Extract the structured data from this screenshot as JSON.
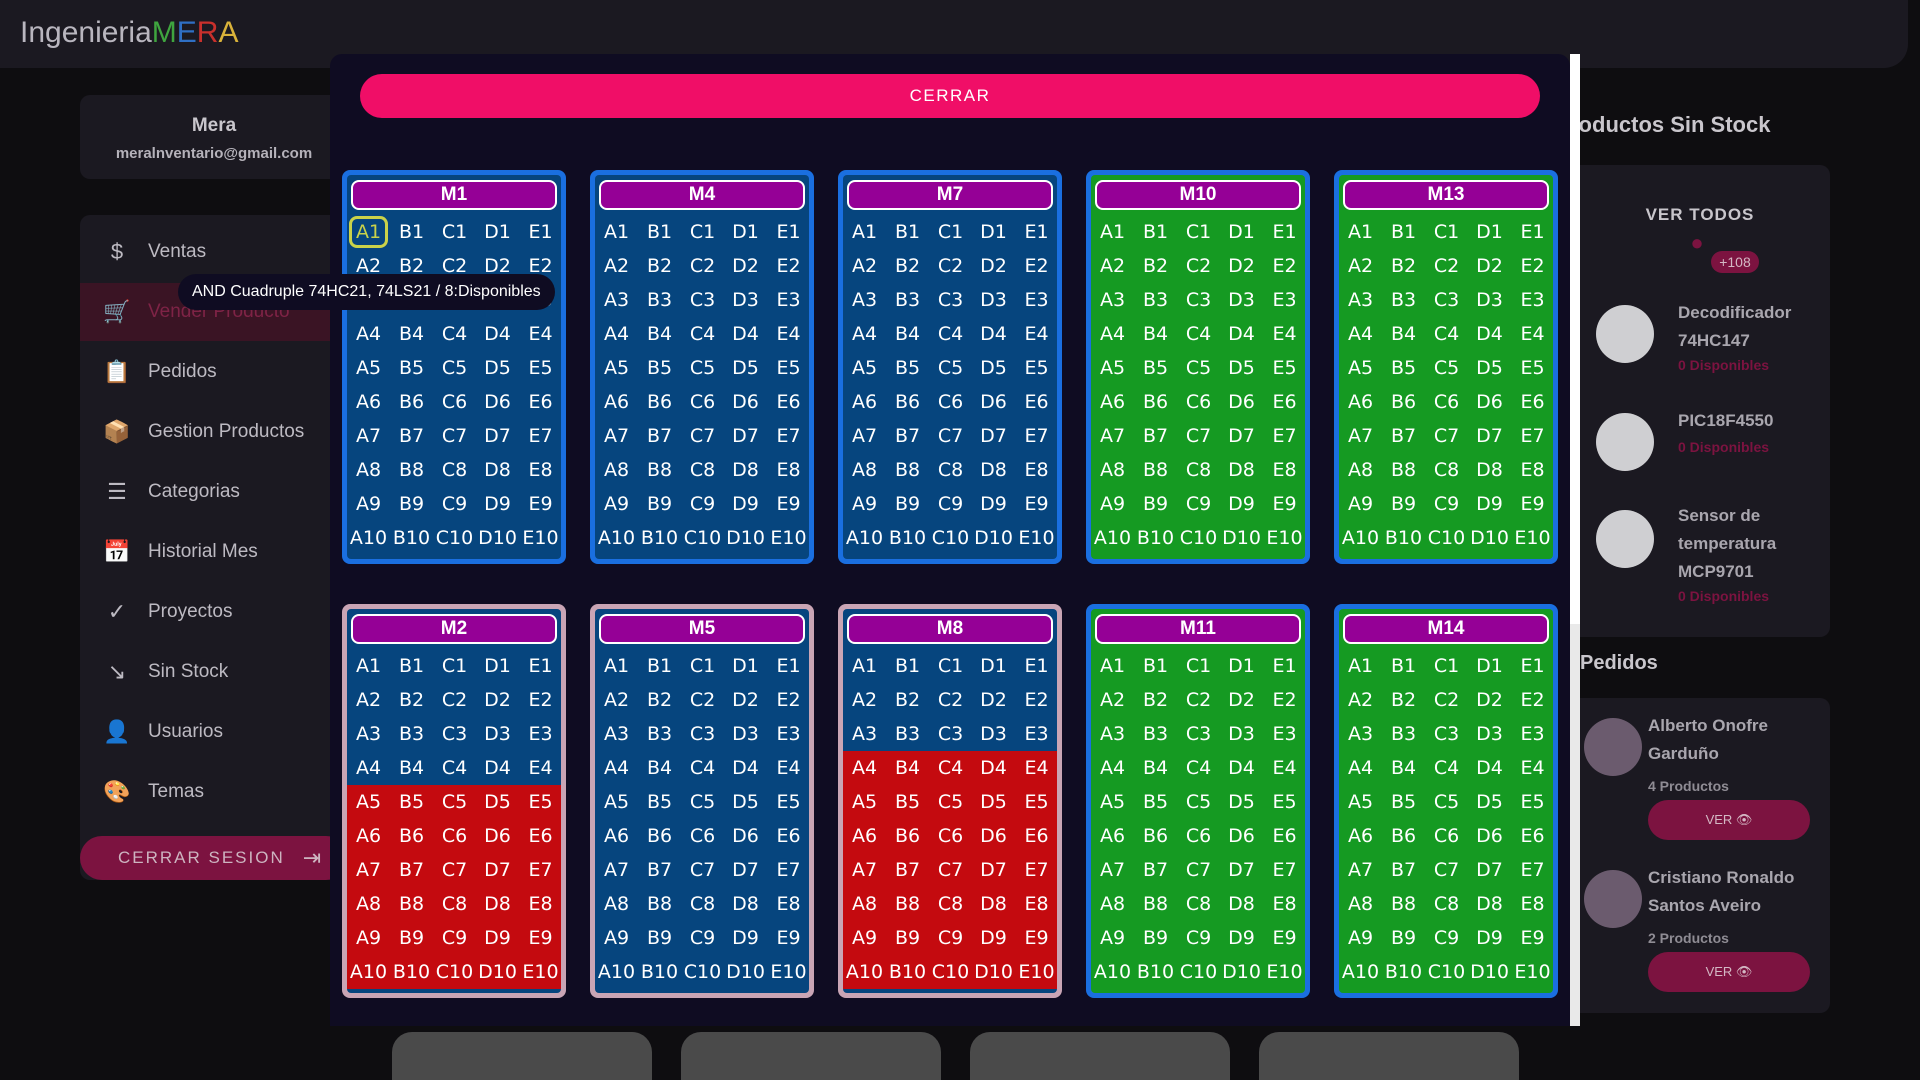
{
  "brand": {
    "prefix": "Ingenieria",
    "m": "M",
    "e": "E",
    "r": "R",
    "a": "A"
  },
  "user": {
    "name": "Mera",
    "email": "meralnventario@gmail.com"
  },
  "sidebar": {
    "items": [
      {
        "label": "Ventas",
        "icon": "dollar-icon",
        "glyph": "$"
      },
      {
        "label": "Vender Producto",
        "icon": "cart-icon",
        "glyph": "🛒",
        "active": true
      },
      {
        "label": "Pedidos",
        "icon": "clipboard-icon",
        "glyph": "📋"
      },
      {
        "label": "Gestion Productos",
        "icon": "box-icon",
        "glyph": "📦"
      },
      {
        "label": "Categorias",
        "icon": "list-icon",
        "glyph": "☰"
      },
      {
        "label": "Historial Mes",
        "icon": "calendar-icon",
        "glyph": "📅"
      },
      {
        "label": "Proyectos",
        "icon": "badge-icon",
        "glyph": "✓"
      },
      {
        "label": "Sin Stock",
        "icon": "trend-down-icon",
        "glyph": "↘"
      },
      {
        "label": "Usuarios",
        "icon": "user-icon",
        "glyph": "👤"
      },
      {
        "label": "Temas",
        "icon": "palette-icon",
        "glyph": "🎨"
      }
    ],
    "logout_label": "CERRAR SESION"
  },
  "right": {
    "title": "roductos Sin Stock",
    "ver_todos": "VER TODOS",
    "badge": "+108",
    "items": [
      {
        "name": "Decodificador 74HC147",
        "avail": "0 Disponibles"
      },
      {
        "name": "PIC18F4550",
        "avail": "0 Disponibles"
      },
      {
        "name": "Sensor de temperatura MCP9701",
        "avail": "0 Disponibles"
      }
    ],
    "pedidos_title": "Pedidos",
    "pedidos": [
      {
        "name": "Alberto Onofre Garduño",
        "count": "4 Productos",
        "ver": "VER"
      },
      {
        "name": "Cristiano Ronaldo Santos Aveiro",
        "count": "2 Productos",
        "ver": "VER"
      }
    ]
  },
  "modal": {
    "close_label": "CERRAR",
    "tooltip": "AND Cuadruple 74HC21, 74LS21 / 8:Disponibles",
    "columns": [
      "A",
      "B",
      "C",
      "D",
      "E"
    ],
    "colors": {
      "blue": "#06457e",
      "green": "#159a22",
      "red": "#c40a0f",
      "head": "#950096"
    },
    "modules": [
      {
        "name": "M1",
        "frame": "#1a6fe0",
        "base": "blue",
        "red_from": 0,
        "selected": "A1"
      },
      {
        "name": "M4",
        "frame": "#1a6fe0",
        "base": "blue",
        "red_from": 0
      },
      {
        "name": "M7",
        "frame": "#1a6fe0",
        "base": "blue",
        "red_from": 0
      },
      {
        "name": "M10",
        "frame": "#1a6fe0",
        "base": "green",
        "red_from": 0
      },
      {
        "name": "M13",
        "frame": "#1a6fe0",
        "base": "green",
        "red_from": 0
      },
      {
        "name": "M2",
        "frame": "#c9a5b5",
        "base": "blue",
        "red_from": 5
      },
      {
        "name": "M5",
        "frame": "#c9a5b5",
        "base": "blue",
        "red_from": 0
      },
      {
        "name": "M8",
        "frame": "#c9a5b5",
        "base": "blue",
        "red_from": 4
      },
      {
        "name": "M11",
        "frame": "#1a6fe0",
        "base": "green",
        "red_from": 0
      },
      {
        "name": "M14",
        "frame": "#1a6fe0",
        "base": "green",
        "red_from": 0
      }
    ]
  }
}
